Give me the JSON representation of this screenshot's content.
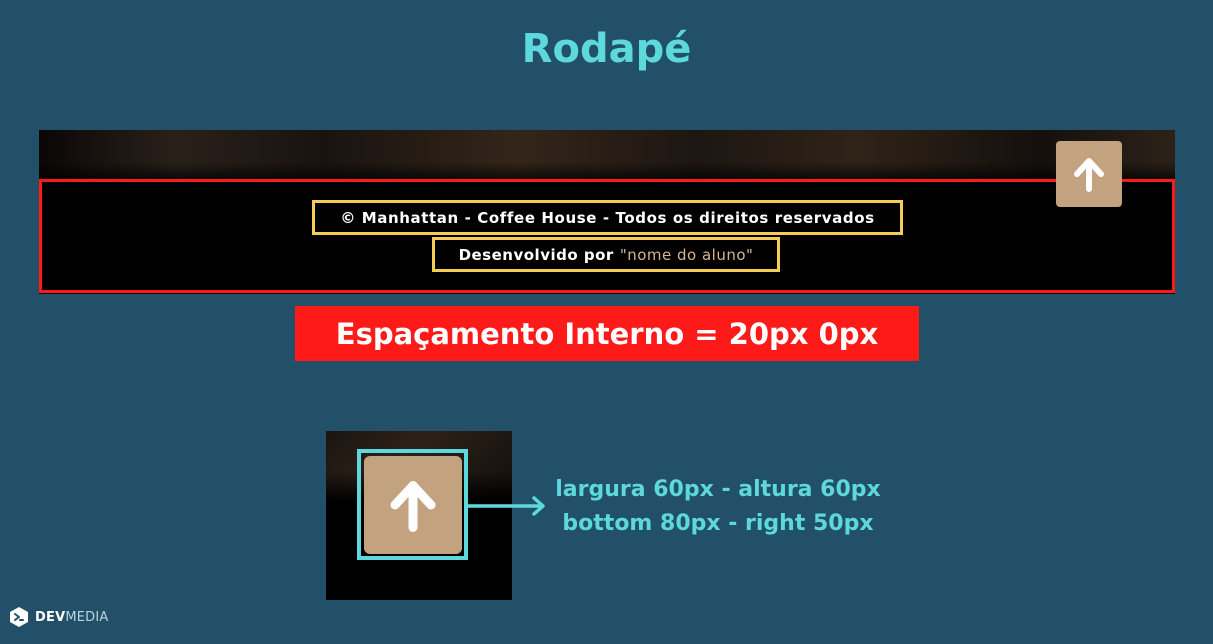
{
  "title": "Rodapé",
  "footer_preview": {
    "copyright": "© Manhattan - Coffee House - Todos os direitos reservados",
    "developed_by": "Desenvolvido por",
    "student_name": "\"nome do aluno\"",
    "back_to_top_icon": "arrow-up-icon"
  },
  "padding_label": "Espaçamento Interno = 20px 0px",
  "button_spec": {
    "size": "largura 60px - altura 60px",
    "position": "bottom 80px - right 50px"
  },
  "logo": {
    "dev": "DEV",
    "media": "MEDIA"
  },
  "colors": {
    "background": "#225068",
    "accent": "#5dd9de",
    "padding_highlight": "#ff1a1a",
    "text_highlight": "#f5cc55",
    "button": "#c3a27f",
    "footer": "#000000"
  }
}
